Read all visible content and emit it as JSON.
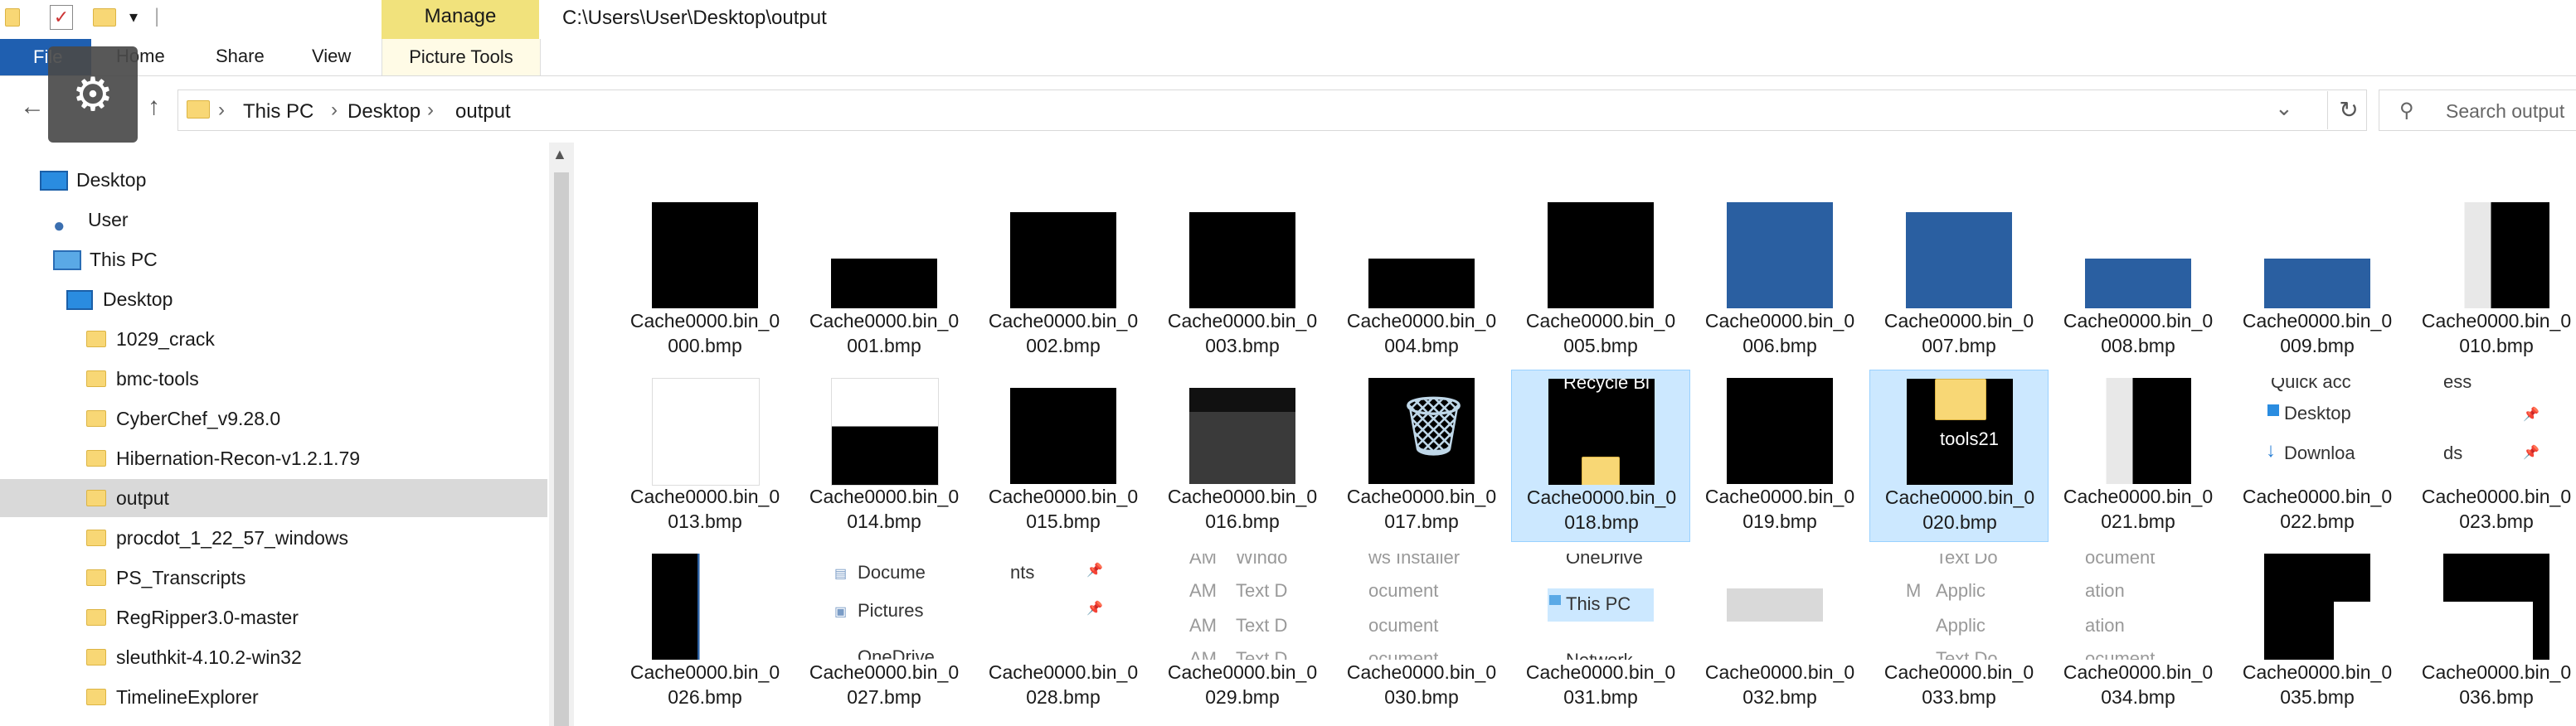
{
  "titlebar": {
    "manage": "Manage",
    "path": "C:\\Users\\User\\Desktop\\output"
  },
  "ribbon": {
    "file": "File",
    "home": "Home",
    "share": "Share",
    "view": "View",
    "picture_tools": "Picture Tools"
  },
  "address": {
    "crumbs": [
      "This PC",
      "Desktop",
      "output"
    ],
    "search_placeholder": "Search output"
  },
  "nav": {
    "items": [
      {
        "label": "Desktop"
      },
      {
        "label": "User"
      },
      {
        "label": "This PC"
      },
      {
        "label": "Desktop"
      },
      {
        "label": "1029_crack"
      },
      {
        "label": "bmc-tools"
      },
      {
        "label": "CyberChef_v9.28.0"
      },
      {
        "label": "Hibernation-Recon-v1.2.1.79"
      },
      {
        "label": "output"
      },
      {
        "label": "procdot_1_22_57_windows"
      },
      {
        "label": "PS_Transcripts"
      },
      {
        "label": "RegRipper3.0-master"
      },
      {
        "label": "sleuthkit-4.10.2-win32"
      },
      {
        "label": "TimelineExplorer"
      }
    ]
  },
  "files": [
    {
      "l1": "Cache0000.bin_0",
      "l2": "000.bmp"
    },
    {
      "l1": "Cache0000.bin_0",
      "l2": "001.bmp"
    },
    {
      "l1": "Cache0000.bin_0",
      "l2": "002.bmp"
    },
    {
      "l1": "Cache0000.bin_0",
      "l2": "003.bmp"
    },
    {
      "l1": "Cache0000.bin_0",
      "l2": "004.bmp"
    },
    {
      "l1": "Cache0000.bin_0",
      "l2": "005.bmp"
    },
    {
      "l1": "Cache0000.bin_0",
      "l2": "006.bmp"
    },
    {
      "l1": "Cache0000.bin_0",
      "l2": "007.bmp"
    },
    {
      "l1": "Cache0000.bin_0",
      "l2": "008.bmp"
    },
    {
      "l1": "Cache0000.bin_0",
      "l2": "009.bmp"
    },
    {
      "l1": "Cache0000.bin_0",
      "l2": "010.bmp"
    },
    {
      "l1": "Cache0000.bin_0",
      "l2": "013.bmp"
    },
    {
      "l1": "Cache0000.bin_0",
      "l2": "014.bmp"
    },
    {
      "l1": "Cache0000.bin_0",
      "l2": "015.bmp"
    },
    {
      "l1": "Cache0000.bin_0",
      "l2": "016.bmp"
    },
    {
      "l1": "Cache0000.bin_0",
      "l2": "017.bmp"
    },
    {
      "l1": "Cache0000.bin_0",
      "l2": "018.bmp"
    },
    {
      "l1": "Cache0000.bin_0",
      "l2": "019.bmp"
    },
    {
      "l1": "Cache0000.bin_0",
      "l2": "020.bmp"
    },
    {
      "l1": "Cache0000.bin_0",
      "l2": "021.bmp"
    },
    {
      "l1": "Cache0000.bin_0",
      "l2": "022.bmp"
    },
    {
      "l1": "Cache0000.bin_0",
      "l2": "023.bmp"
    },
    {
      "l1": "Cache0000.bin_0",
      "l2": "026.bmp"
    },
    {
      "l1": "Cache0000.bin_0",
      "l2": "027.bmp"
    },
    {
      "l1": "Cache0000.bin_0",
      "l2": "028.bmp"
    },
    {
      "l1": "Cache0000.bin_0",
      "l2": "029.bmp"
    },
    {
      "l1": "Cache0000.bin_0",
      "l2": "030.bmp"
    },
    {
      "l1": "Cache0000.bin_0",
      "l2": "031.bmp"
    },
    {
      "l1": "Cache0000.bin_0",
      "l2": "032.bmp"
    },
    {
      "l1": "Cache0000.bin_0",
      "l2": "033.bmp"
    },
    {
      "l1": "Cache0000.bin_0",
      "l2": "034.bmp"
    },
    {
      "l1": "Cache0000.bin_0",
      "l2": "035.bmp"
    },
    {
      "l1": "Cache0000.bin_0",
      "l2": "036.bmp"
    }
  ],
  "thumb_text": {
    "recycle": "Recycle Bi",
    "tools21": "tools21",
    "quick": "Quick acc",
    "ess": "ess",
    "desktop": "Desktop",
    "downloa": "Downloa",
    "ds": "ds",
    "docume": "Docume",
    "pictures": "Pictures",
    "onedrive": "OneDrive",
    "nts": "nts",
    "windo": "Windo",
    "am": "AM",
    "text_d": "Text D",
    "ws_installer": "ws Installer",
    "ocument": "ocument",
    "onedrive2": "OneDrive",
    "this_pc": "This PC",
    "network": "Network",
    "text_doc": "Text Do",
    "m": "M",
    "applic": "Applic",
    "ocument2": "ocument",
    "ation": "ation"
  },
  "colors": {
    "selection": "#cce8ff",
    "thumb_blue": "#2a5fa1",
    "manage": "#f1e27c",
    "file_tab": "#1f5fb0"
  }
}
